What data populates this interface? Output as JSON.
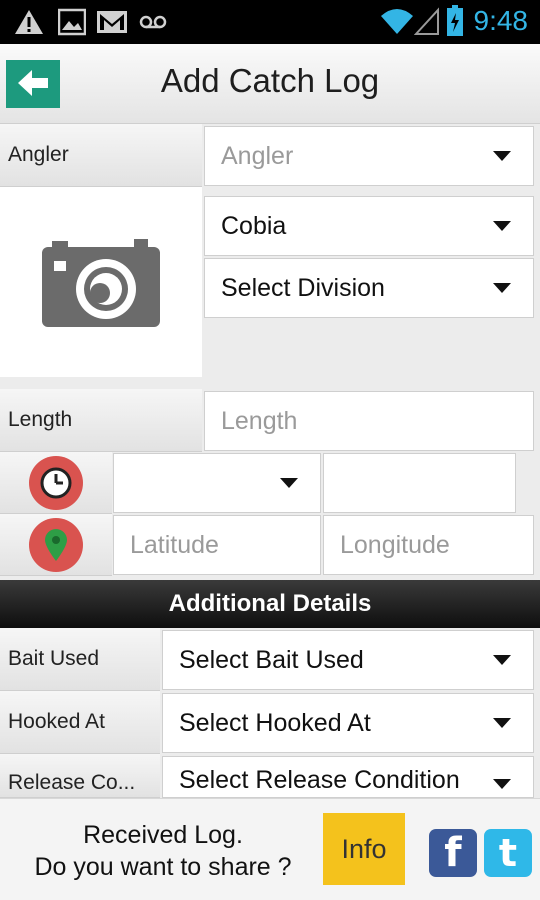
{
  "status_bar": {
    "time": "9:48",
    "icons": [
      "warning-icon",
      "image-icon",
      "gmail-icon",
      "voicemail-icon",
      "wifi-icon",
      "signal-icon",
      "battery-icon"
    ]
  },
  "header": {
    "title": "Add Catch Log",
    "back_icon": "arrow-left-icon"
  },
  "form": {
    "angler_label": "Angler",
    "angler_placeholder": "Angler",
    "species_value": "Cobia",
    "division_value": "Select Division",
    "length_label": "Length",
    "length_placeholder": "Length",
    "time_value": "",
    "latitude_placeholder": "Latitude",
    "longitude_placeholder": "Longitude"
  },
  "additional": {
    "title": "Additional Details",
    "bait_label": "Bait Used",
    "bait_value": "Select Bait Used",
    "hooked_label": "Hooked At",
    "hooked_value": "Select Hooked At",
    "release_label": "Release Co...",
    "release_value": "Select Release Condition"
  },
  "share": {
    "line1": "Received Log.",
    "line2": "Do you want to share ?",
    "info_label": "Info",
    "facebook_glyph": "f",
    "twitter_glyph": "t"
  },
  "colors": {
    "accent": "#1d9a7e",
    "status_blue": "#33b5e5",
    "icon_red": "#d9534f",
    "info_yellow": "#f4c21c",
    "facebook": "#3b5998",
    "twitter": "#2fb8e8"
  }
}
